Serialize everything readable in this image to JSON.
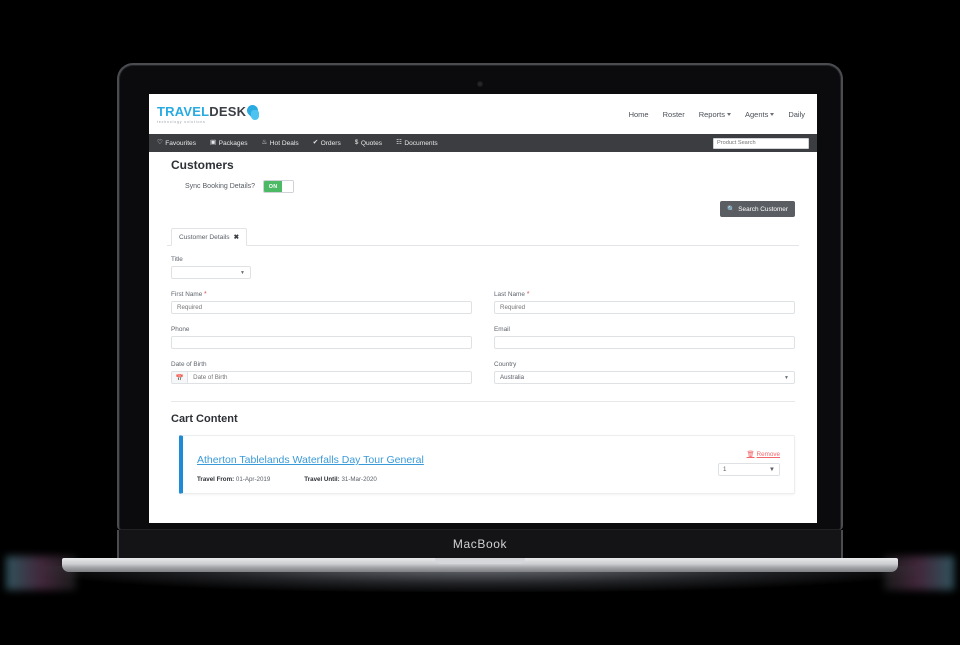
{
  "device": {
    "label": "MacBook"
  },
  "brand": {
    "name_part1": "TRAVEL",
    "name_part2": "DESK",
    "tagline": "technology solutions"
  },
  "top_nav": {
    "items": [
      {
        "label": "Home",
        "has_caret": false
      },
      {
        "label": "Roster",
        "has_caret": false
      },
      {
        "label": "Reports",
        "has_caret": true
      },
      {
        "label": "Agents",
        "has_caret": true
      },
      {
        "label": "Daily",
        "has_caret": false
      }
    ]
  },
  "main_nav": {
    "items": [
      {
        "icon": "heart-icon",
        "glyph": "♡",
        "label": "Favourites"
      },
      {
        "icon": "package-icon",
        "glyph": "▣",
        "label": "Packages"
      },
      {
        "icon": "flame-icon",
        "glyph": "♨",
        "label": "Hot Deals"
      },
      {
        "icon": "check-icon",
        "glyph": "✔",
        "label": "Orders"
      },
      {
        "icon": "dollar-icon",
        "glyph": "$",
        "label": "Quotes"
      },
      {
        "icon": "document-icon",
        "glyph": "☷",
        "label": "Documents"
      }
    ],
    "search": {
      "placeholder": "Product Search",
      "value": ""
    }
  },
  "customers": {
    "heading": "Customers",
    "sync_label": "Sync Booking Details?",
    "sync_state": "ON",
    "search_button": "Search Customer",
    "search_icon": "🔍"
  },
  "tabs": [
    {
      "label": "Customer Details",
      "close_glyph": "✖",
      "active": true
    }
  ],
  "form": {
    "title": {
      "label": "Title",
      "value": "",
      "placeholder": ""
    },
    "first_name": {
      "label": "First Name",
      "required": true,
      "value": "",
      "placeholder": "Required"
    },
    "last_name": {
      "label": "Last Name",
      "required": true,
      "value": "",
      "placeholder": "Required"
    },
    "phone": {
      "label": "Phone",
      "value": "",
      "placeholder": ""
    },
    "email": {
      "label": "Email",
      "value": "",
      "placeholder": ""
    },
    "date_of_birth": {
      "label": "Date of Birth",
      "value": "",
      "placeholder": "Date of Birth",
      "icon": "calendar-icon",
      "icon_glyph": "Ὄ5"
    },
    "country": {
      "label": "Country",
      "value": "Australia"
    }
  },
  "cart": {
    "heading": "Cart Content",
    "items": [
      {
        "title": "Atherton Tablelands Waterfalls Day Tour General",
        "travel_from_label": "Travel From:",
        "travel_from_value": "01-Apr-2019",
        "travel_until_label": "Travel Until:",
        "travel_until_value": "31-Mar-2020",
        "remove_label": "Remove",
        "remove_icon": "trash-icon",
        "quantity": "1"
      }
    ]
  },
  "colors": {
    "brand_blue": "#29abe2",
    "nav_dark": "#3b3d40",
    "toggle_green": "#4cb964",
    "accent_blue": "#1f8ad6",
    "link_blue": "#3a9ad9",
    "remove_red": "#f0666b",
    "required_red": "#d9534f"
  }
}
